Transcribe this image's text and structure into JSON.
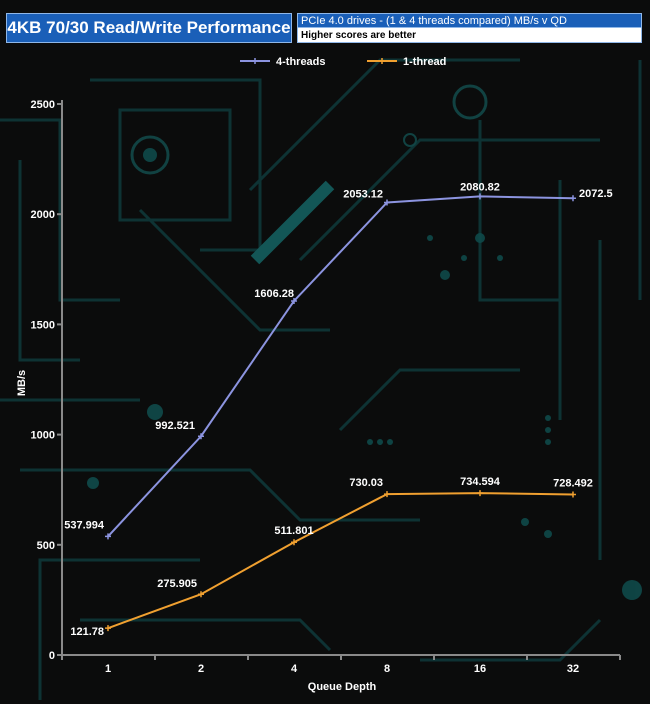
{
  "header": {
    "title": "4KB 70/30 Read/Write Performance",
    "subtitle": "PCIe 4.0 drives - (1 & 4 threads compared) MB/s v QD",
    "note": "Higher scores are better"
  },
  "chart_data": {
    "type": "line",
    "categories": [
      "1",
      "2",
      "4",
      "8",
      "16",
      "32"
    ],
    "xlabel": "Queue Depth",
    "ylabel": "MB/s",
    "ylim": [
      0,
      2500
    ],
    "yticks": [
      "0",
      "500",
      "1000",
      "1500",
      "2000",
      "2500"
    ],
    "legend_position": "top",
    "series": [
      {
        "name": "4-threads",
        "color": "#8c94e0",
        "values": [
          537.994,
          992.521,
          1606.28,
          2053.12,
          2080.82,
          2072.5
        ],
        "labels": [
          "537.994",
          "992.521",
          "1606.28",
          "2053.12",
          "2080.82",
          "2072.5"
        ]
      },
      {
        "name": "1-thread",
        "color": "#f0a030",
        "values": [
          121.78,
          275.905,
          511.801,
          730.03,
          734.594,
          728.492
        ],
        "labels": [
          "121.78",
          "275.905",
          "511.801",
          "730.03",
          "734.594",
          "728.492"
        ]
      }
    ]
  }
}
